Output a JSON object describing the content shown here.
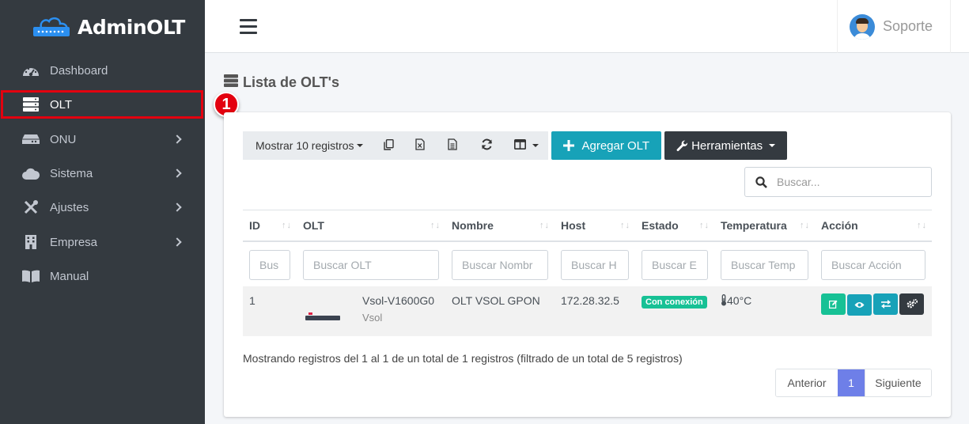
{
  "brand": {
    "name": "AdminOLT"
  },
  "sidebar": {
    "items": [
      {
        "label": "Dashboard",
        "icon": "tachometer-icon"
      },
      {
        "label": "OLT",
        "icon": "server-icon"
      },
      {
        "label": "ONU",
        "icon": "hdd-icon"
      },
      {
        "label": "Sistema",
        "icon": "cloud-icon"
      },
      {
        "label": "Ajustes",
        "icon": "tools-icon"
      },
      {
        "label": "Empresa",
        "icon": "building-icon"
      },
      {
        "label": "Manual",
        "icon": "book-icon"
      }
    ],
    "step_badge": "1"
  },
  "topbar": {
    "user_name": "Soporte"
  },
  "page": {
    "title": "Lista de OLT's"
  },
  "toolbar": {
    "show_records": "Mostrar 10 registros",
    "add_label": "Agregar OLT",
    "tools_label": "Herramientas"
  },
  "search": {
    "placeholder": "Buscar..."
  },
  "table": {
    "headers": [
      "ID",
      "OLT",
      "Nombre",
      "Host",
      "Estado",
      "Temperatura",
      "Acción"
    ],
    "filters": [
      "Bus",
      "Buscar OLT",
      "Buscar Nombr",
      "Buscar H",
      "Buscar E",
      "Buscar Temp",
      "Buscar Acción"
    ],
    "rows": [
      {
        "id": "1",
        "olt_model": "Vsol-V1600G0",
        "olt_brand": "Vsol",
        "nombre": "OLT VSOL GPON",
        "host": "172.28.32.5",
        "estado": "Con conexión",
        "temperatura": "40°C"
      }
    ]
  },
  "footer": {
    "info": "Mostrando registros del 1 al 1 de un total de 1 registros (filtrado de un total de 5 registros)",
    "prev": "Anterior",
    "page": "1",
    "next": "Siguiente"
  },
  "colors": {
    "sidebar_bg": "#343a40",
    "info": "#17a2b8",
    "dark": "#343a40",
    "success": "#17c195",
    "highlight": "#e3000f",
    "pager_active": "#6e7fe8"
  }
}
